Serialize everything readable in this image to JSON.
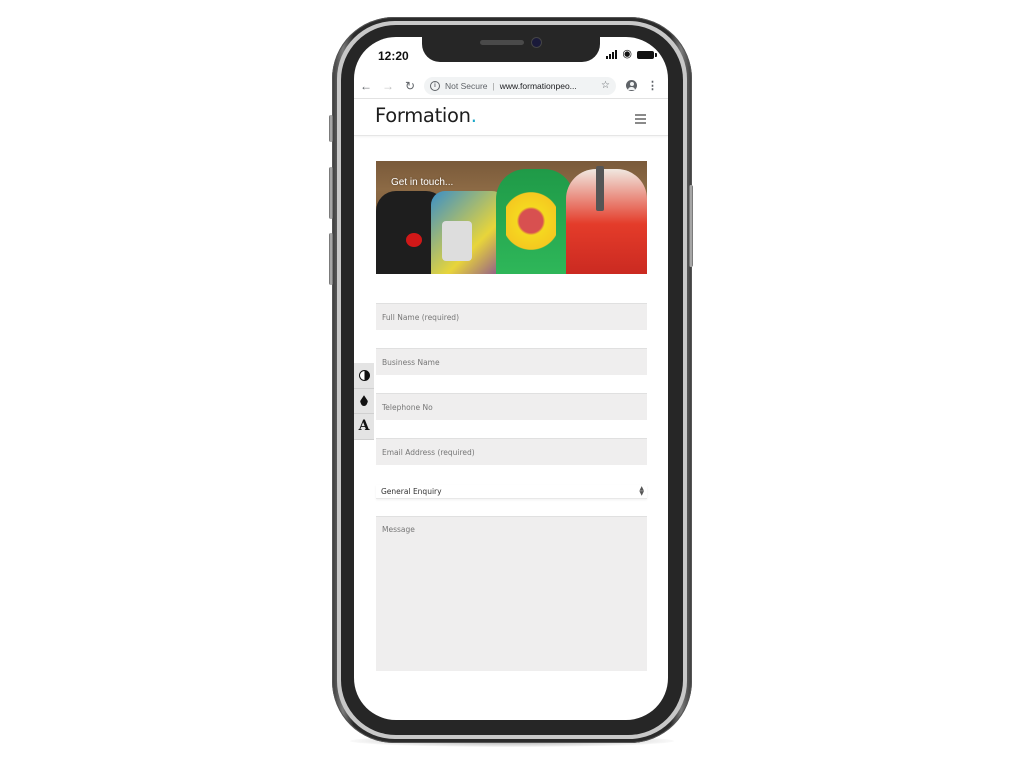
{
  "status_bar": {
    "time": "12:20",
    "icons": [
      "cellular-signal-icon",
      "wifi-icon",
      "battery-icon"
    ]
  },
  "browser": {
    "back_icon": "←",
    "forward_icon": "→",
    "reload_icon": "↻",
    "security_label": "Not Secure",
    "url": "www.formationpeo...",
    "bookmark_icon": "☆",
    "menu_icon": "⋮"
  },
  "site": {
    "logo_text": "Formation",
    "logo_dot": ".",
    "logo_dot_color": "#1aa7c8"
  },
  "hero": {
    "title": "Get in touch..."
  },
  "form": {
    "fields": [
      {
        "placeholder": "Full Name (required)"
      },
      {
        "placeholder": "Business Name"
      },
      {
        "placeholder": "Telephone No"
      },
      {
        "placeholder": "Email Address (required)"
      }
    ],
    "enquiry_select": {
      "selected": "General Enquiry"
    },
    "message": {
      "placeholder": "Message"
    }
  },
  "accessibility_toolbar": {
    "items": [
      {
        "name": "contrast-toggle",
        "icon": "contrast-icon"
      },
      {
        "name": "desaturate-toggle",
        "icon": "ink-drop-icon"
      },
      {
        "name": "font-size-toggle",
        "icon": "font-icon",
        "glyph": "A"
      }
    ]
  }
}
